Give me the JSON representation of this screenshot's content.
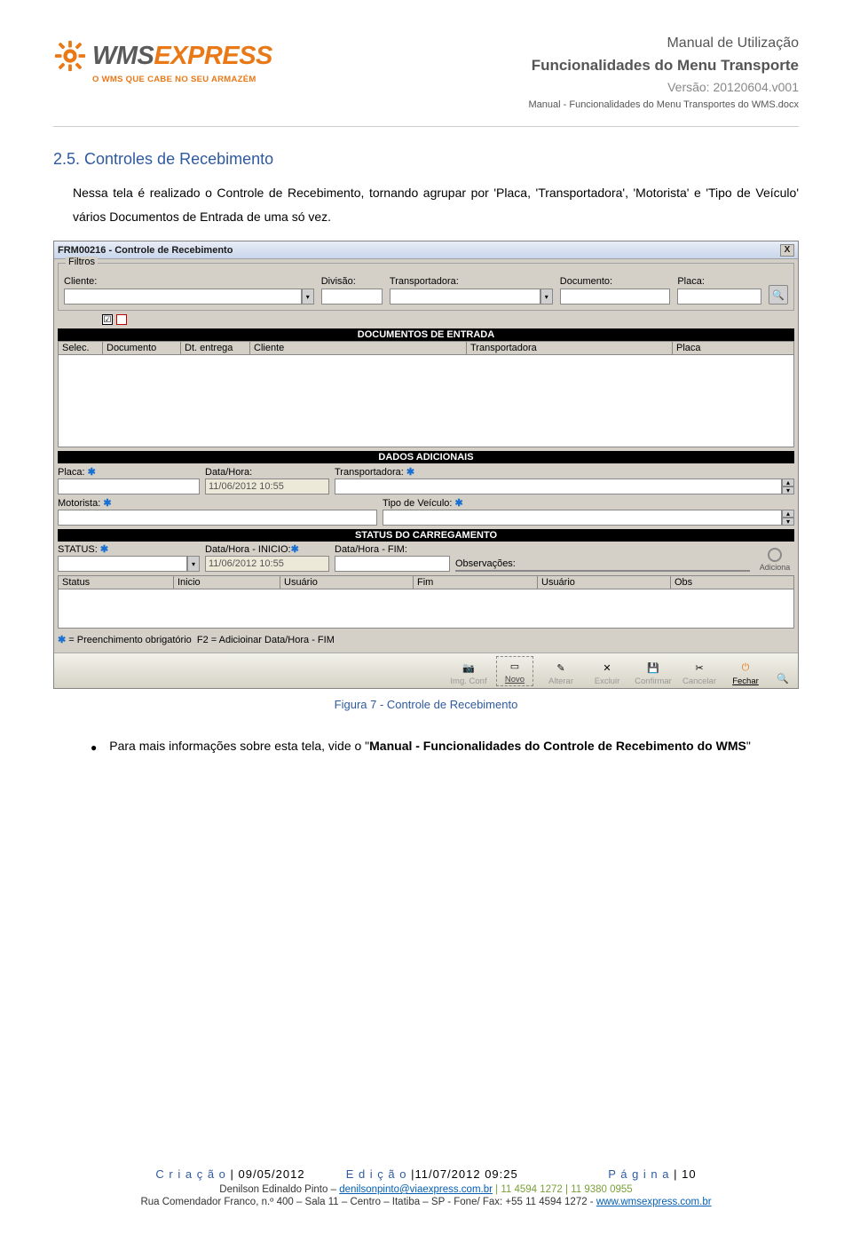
{
  "header": {
    "brand_wms": "WMS",
    "brand_express": "EXPRESS",
    "tagline": "O WMS QUE CABE NO SEU ARMAZÉM",
    "line1": "Manual de Utilização",
    "line2": "Funcionalidades do Menu Transporte",
    "version": "Versão: 20120604.v001",
    "file": "Manual - Funcionalidades do Menu Transportes do WMS.docx"
  },
  "section": {
    "title": "2.5.   Controles de Recebimento",
    "paragraph": "Nessa tela é realizado o Controle de Recebimento, tornando agrupar por 'Placa, 'Transportadora', 'Motorista' e 'Tipo de Veículo' vários Documentos de Entrada de uma só vez."
  },
  "window": {
    "title": "FRM00216 - Controle de Recebimento",
    "close": "X",
    "filters_legend": "Filtros",
    "filters": {
      "cliente": "Cliente:",
      "divisao": "Divisão:",
      "transportadora": "Transportadora:",
      "documento": "Documento:",
      "placa": "Placa:"
    },
    "bar1": "DOCUMENTOS DE ENTRADA",
    "check_on": "☑",
    "grid1": {
      "c1": "Selec.",
      "c2": "Documento",
      "c3": "Dt. entrega",
      "c4": "Cliente",
      "c5": "Transportadora",
      "c6": "Placa"
    },
    "bar2": "DADOS ADICIONAIS",
    "ad": {
      "placa": "Placa:",
      "datahora": "Data/Hora:",
      "datahora_val": "11/06/2012 10:55",
      "transportadora": "Transportadora:",
      "motorista": "Motorista:",
      "tipo": "Tipo de Veículo:"
    },
    "bar3": "STATUS DO CARREGAMENTO",
    "st": {
      "status": "STATUS:",
      "ini": "Data/Hora - INICIO:",
      "ini_val": "11/06/2012 10:55",
      "fim": "Data/Hora - FIM:",
      "obs": "Observações:",
      "add": "Adiciona"
    },
    "grid2": {
      "c1": "Status",
      "c2": "Inicio",
      "c3": "Usuário",
      "c4": "Fim",
      "c5": "Usuário",
      "c6": "Obs"
    },
    "footnote": "✱ = Preenchimento obrigatório  F2 = Adicioinar Data/Hora - FIM",
    "toolbar": {
      "imgconf": "Img. Conf",
      "novo": "Novo",
      "alterar": "Alterar",
      "excluir": "Excluir",
      "confirmar": "Confirmar",
      "cancelar": "Cancelar",
      "fechar": "Fechar"
    }
  },
  "caption": "Figura 7 - Controle de Recebimento",
  "bullet": {
    "pre": "Para mais informações sobre esta tela, vide o \"",
    "bold": "Manual - Funcionalidades do Controle de Recebimento do WMS",
    "post": "\""
  },
  "footer": {
    "cria_k": "C r i a ç ã o",
    "cria_v": " | 09/05/2012",
    "edi_k": "E d i ç ã o",
    "edi_v": " |11/07/2012 09:25",
    "pg_k": "P á g i n a",
    "pg_v": " | 10",
    "author": "Denilson Edinaldo Pinto – ",
    "mail": "denilsonpinto@viaexpress.com.br",
    "phones": " | 11 4594 1272 | 11 9380 0955",
    "addr_pre": "Rua Comendador Franco, n.º 400 – Sala 11 – Centro – Itatiba – SP - Fone/ Fax: +55 11 4594 1272 - ",
    "url": "www.wmsexpress.com.br"
  }
}
